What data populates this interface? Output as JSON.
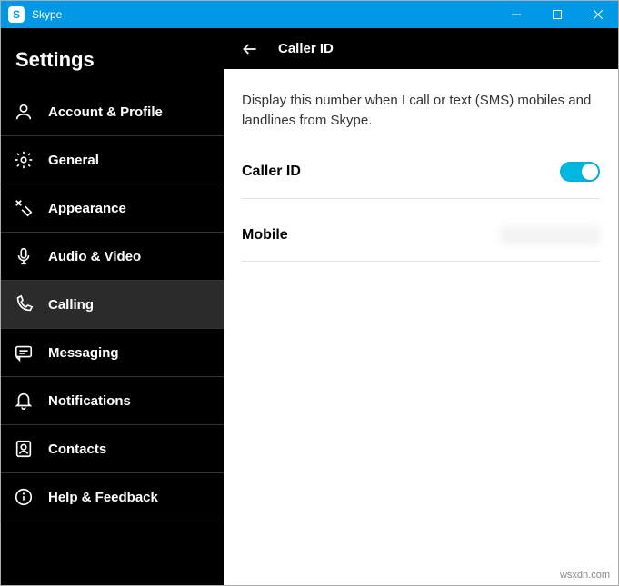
{
  "titlebar": {
    "app_name": "Skype",
    "icon_letter": "S"
  },
  "sidebar": {
    "title": "Settings",
    "items": [
      {
        "id": "account-profile",
        "label": "Account & Profile"
      },
      {
        "id": "general",
        "label": "General"
      },
      {
        "id": "appearance",
        "label": "Appearance"
      },
      {
        "id": "audio-video",
        "label": "Audio & Video"
      },
      {
        "id": "calling",
        "label": "Calling",
        "active": true
      },
      {
        "id": "messaging",
        "label": "Messaging"
      },
      {
        "id": "notifications",
        "label": "Notifications"
      },
      {
        "id": "contacts",
        "label": "Contacts"
      },
      {
        "id": "help-feedback",
        "label": "Help & Feedback"
      }
    ]
  },
  "content": {
    "title": "Caller ID",
    "description": "Display this number when I call or text (SMS) mobiles and landlines from Skype.",
    "caller_id_label": "Caller ID",
    "caller_id_enabled": true,
    "mobile_label": "Mobile"
  },
  "watermark": "wsxdn.com"
}
